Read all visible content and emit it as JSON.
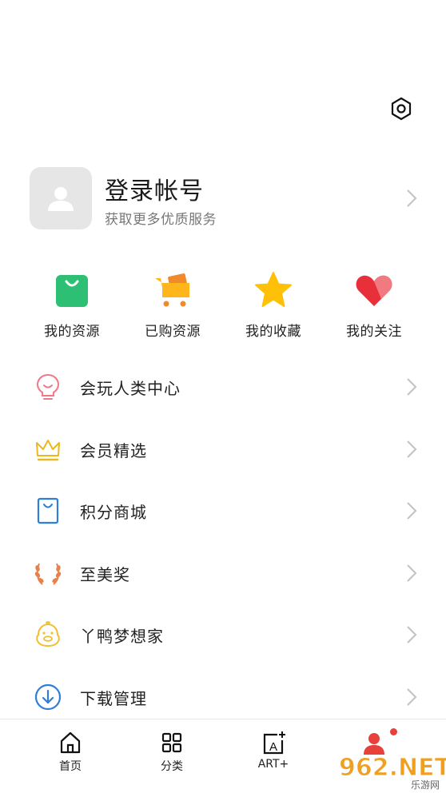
{
  "header": {
    "settings_icon": "settings-hexagon-icon"
  },
  "profile": {
    "title": "登录帐号",
    "subtitle": "获取更多优质服务",
    "avatar_icon": "user-placeholder-icon"
  },
  "quick_actions": [
    {
      "label": "我的资源",
      "icon": "shopping-bag-icon",
      "color": "#2dbf73"
    },
    {
      "label": "已购资源",
      "icon": "shopping-cart-icon",
      "color": "#ffb61d"
    },
    {
      "label": "我的收藏",
      "icon": "star-icon",
      "color": "#ffc107"
    },
    {
      "label": "我的关注",
      "icon": "heart-icon",
      "color": "#e8303a"
    }
  ],
  "menu": [
    {
      "label": "会玩人类中心",
      "icon": "lightbulb-face-icon",
      "color": "#f07887"
    },
    {
      "label": "会员精选",
      "icon": "crown-icon",
      "color": "#e8b920"
    },
    {
      "label": "积分商城",
      "icon": "shopping-bag-outline-icon",
      "color": "#2f7fd8"
    },
    {
      "label": "至美奖",
      "icon": "laurel-wreath-icon",
      "color": "#e8804a"
    },
    {
      "label": "丫鸭梦想家",
      "icon": "duck-icon",
      "color": "#f0c030"
    },
    {
      "label": "下载管理",
      "icon": "download-circle-icon",
      "color": "#2f7fd8"
    }
  ],
  "tabbar": [
    {
      "label": "首页",
      "icon": "home-icon"
    },
    {
      "label": "分类",
      "icon": "grid-icon"
    },
    {
      "label": "ART+",
      "icon": "art-plus-icon"
    },
    {
      "label": "",
      "icon": "profile-icon",
      "active_color": "#e8403a"
    }
  ],
  "watermark": {
    "text": "962.NET",
    "subtext": "乐游网"
  }
}
